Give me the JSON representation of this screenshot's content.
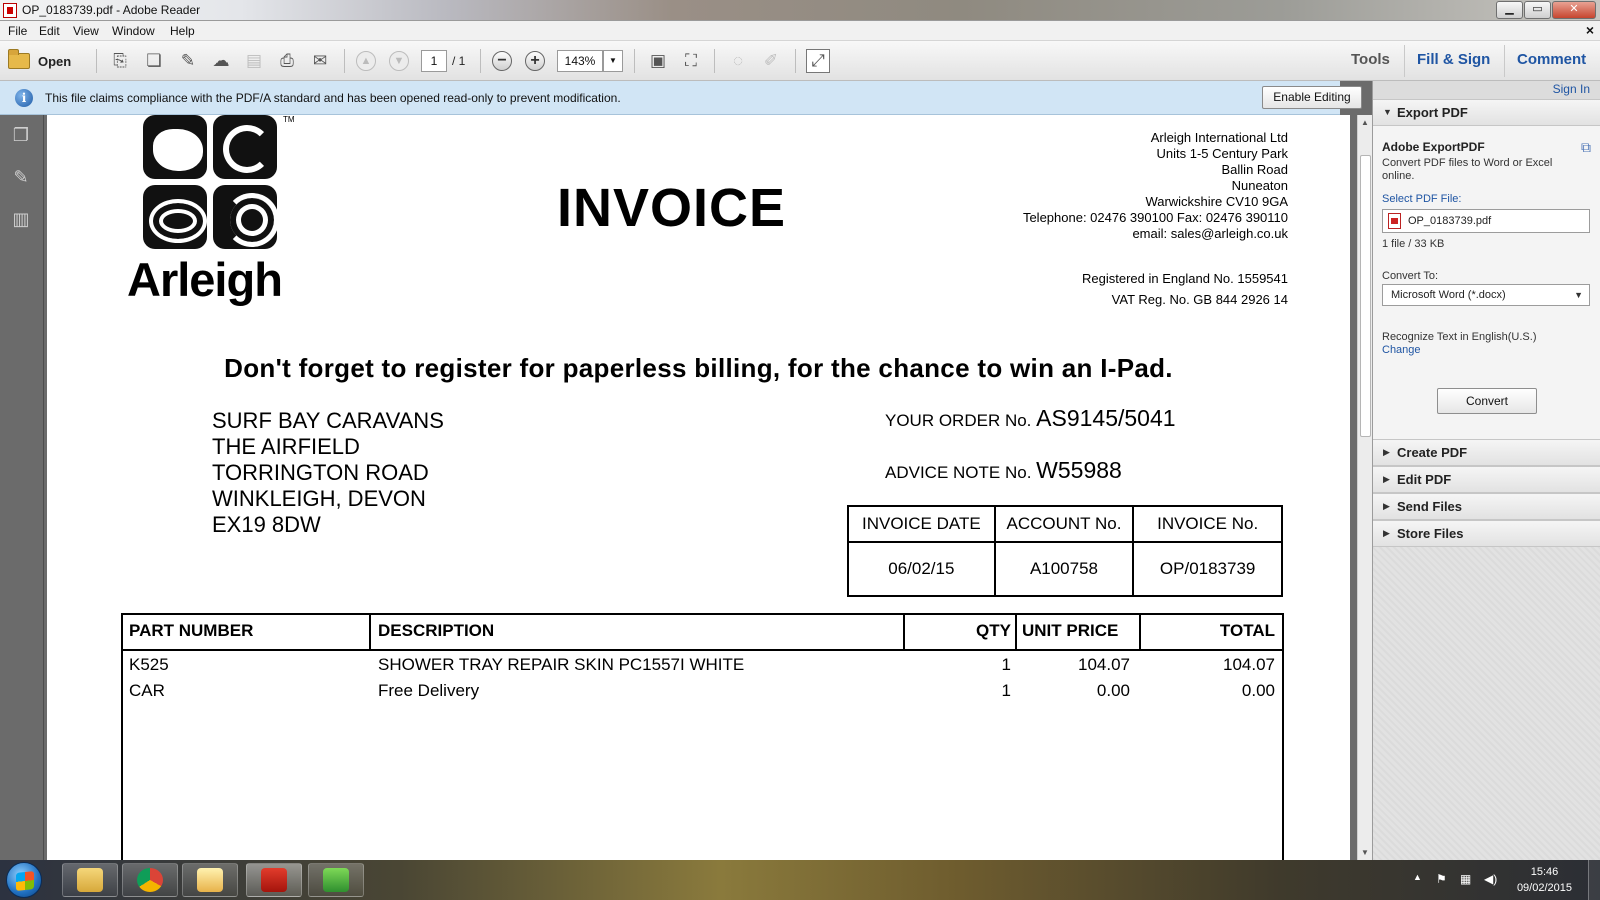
{
  "window": {
    "title": "OP_0183739.pdf - Adobe Reader",
    "min_glyph": "▁",
    "max_glyph": "▭",
    "close_glyph": "✕"
  },
  "menubar": {
    "items": [
      "File",
      "Edit",
      "View",
      "Window",
      "Help"
    ],
    "close_glyph": "×"
  },
  "toolbar": {
    "open_label": "Open",
    "current_page": "1",
    "total_pages": "/ 1",
    "zoom": "143%",
    "tabs": [
      "Tools",
      "Fill & Sign",
      "Comment"
    ]
  },
  "infobar": {
    "message": "This file claims compliance with the PDF/A standard and has been opened read-only to prevent modification.",
    "enable_editing_label": "Enable Editing"
  },
  "invoice": {
    "logo_text": "Arleigh",
    "logo_tm": "TM",
    "title": "INVOICE",
    "company_address": [
      "Arleigh International Ltd",
      "Units 1-5 Century Park",
      "Ballin Road",
      "Nuneaton",
      "Warwickshire CV10 9GA",
      "Telephone: 02476 390100 Fax: 02476 390110",
      "email: sales@arleigh.co.uk"
    ],
    "registration": [
      "Registered in England No. 1559541",
      "VAT Reg. No. GB 844 2926 14"
    ],
    "promo": "Don't forget to register for paperless billing, for the chance to win an I-Pad.",
    "customer_address": [
      "SURF BAY CARAVANS",
      "THE AIRFIELD",
      "TORRINGTON ROAD",
      "WINKLEIGH, DEVON",
      "EX19 8DW"
    ],
    "order_label": "YOUR ORDER No.",
    "order_no": "AS9145/5041",
    "advice_label": "ADVICE NOTE No.",
    "advice_no": "W55988",
    "date_box": {
      "headers": [
        "INVOICE DATE",
        "ACCOUNT No.",
        "INVOICE No."
      ],
      "values": [
        "06/02/15",
        "A100758",
        "OP/0183739"
      ]
    },
    "items_headers": [
      "PART NUMBER",
      "DESCRIPTION",
      "QTY",
      "UNIT PRICE",
      "TOTAL"
    ],
    "items": [
      {
        "part": "K525",
        "description": "SHOWER TRAY REPAIR SKIN PC1557I WHITE",
        "qty": "1",
        "unit_price": "104.07",
        "total": "104.07"
      },
      {
        "part": "CAR",
        "description": "Free Delivery",
        "qty": "1",
        "unit_price": "0.00",
        "total": "0.00"
      }
    ]
  },
  "right_panel": {
    "sign_in": "Sign In",
    "export_pdf": {
      "header": "Export PDF",
      "title": "Adobe ExportPDF",
      "description": "Convert PDF files to Word or Excel online.",
      "select_label": "Select PDF File:",
      "file_name": "OP_0183739.pdf",
      "file_info": "1 file / 33 KB",
      "convert_to_label": "Convert To:",
      "convert_to_value": "Microsoft Word (*.docx)",
      "recognize_text": "Recognize Text in English(U.S.)",
      "change_link": "Change",
      "convert_button": "Convert"
    },
    "sections": [
      "Create PDF",
      "Edit PDF",
      "Send Files",
      "Store Files"
    ]
  },
  "taskbar": {
    "time": "15:46",
    "date": "09/02/2015"
  }
}
